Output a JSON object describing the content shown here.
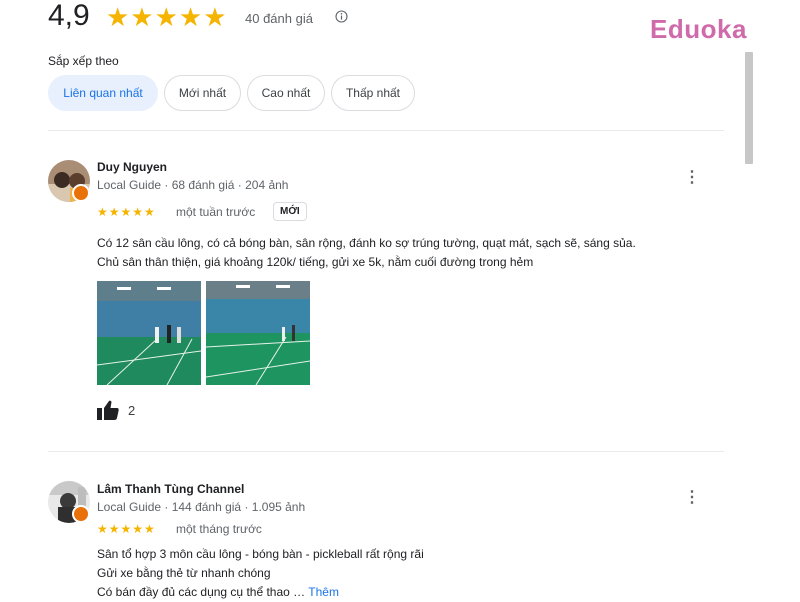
{
  "summary": {
    "rating": "4,9",
    "stars": "★★★★★",
    "review_count": "40 đánh giá"
  },
  "brand": {
    "name": "Eduoka",
    "color": "#d06bab"
  },
  "sort": {
    "label": "Sắp xếp theo",
    "options": [
      {
        "label": "Liên quan nhất",
        "selected": true
      },
      {
        "label": "Mới nhất",
        "selected": false
      },
      {
        "label": "Cao nhất",
        "selected": false
      },
      {
        "label": "Thấp nhất",
        "selected": false
      }
    ]
  },
  "reviews": [
    {
      "name": "Duy Nguyen",
      "meta": "Local Guide · 68 đánh giá · 204 ảnh",
      "stars": "★★★★★",
      "time": "một tuần trước",
      "badge": "MỚI",
      "text_lines": [
        "Có 12 sân cầu lông, có cả bóng bàn, sân rộng, đánh ko sợ trúng tường, quạt mát, sạch sẽ, sáng sủa.",
        "Chủ sân thân thiện, giá khoảng 120k/ tiếng, gửi xe 5k, nằm cuối đường trong hẻm"
      ],
      "likes": "2"
    },
    {
      "name": "Lâm Thanh Tùng Channel",
      "meta": "Local Guide · 144 đánh giá · 1.095 ảnh",
      "stars": "★★★★★",
      "time": "một tháng trước",
      "text_lines": [
        "Sân tổ hợp 3 môn cầu lông - bóng bàn - pickleball rất rộng rãi",
        "Gửi xe bằng thẻ từ nhanh chóng",
        "Có bán đầy đủ các dụng cụ thể thao …"
      ],
      "more_label": "Thêm"
    }
  ],
  "colors": {
    "star": "#f5b400",
    "accent": "#1a73e8",
    "chip_active_bg": "#e8f0fe"
  }
}
